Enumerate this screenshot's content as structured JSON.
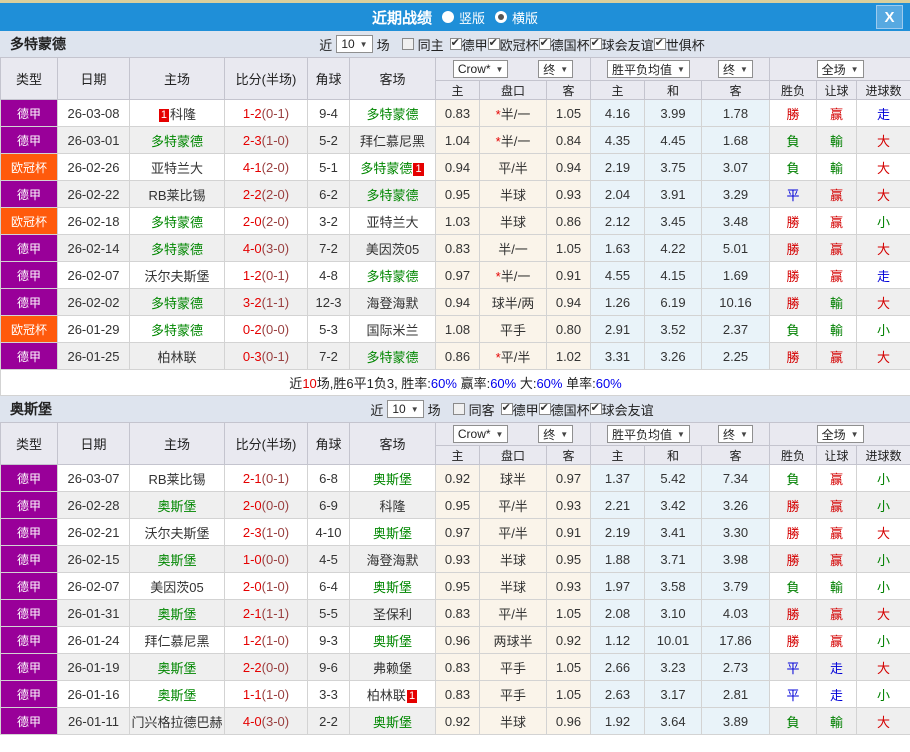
{
  "titlebar": {
    "title": "近期战绩",
    "radios": [
      {
        "label": "竖版",
        "selected": false
      },
      {
        "label": "横版",
        "selected": true
      }
    ],
    "close_label": "X"
  },
  "filter": {
    "near_label": "近",
    "near_value": "10",
    "games_label": "场"
  },
  "table_header": {
    "main_cols": [
      "类型",
      "日期",
      "主场",
      "比分(半场)",
      "角球",
      "客场"
    ],
    "sub_cols": [
      "主",
      "盘口",
      "客",
      "主",
      "和",
      "客",
      "胜负",
      "让球",
      "进球数"
    ],
    "odds_select": "Crow*",
    "odds_final_select": "终",
    "avg_select": "胜平负均值",
    "avg_final_select": "终",
    "scope_select": "全场"
  },
  "colors": {
    "titlebar_blue": "#1f8fd8",
    "top_strip": "#d9cf9d",
    "league_purple": "#990099",
    "league_orange": "#ff5a0c",
    "team_green": "#008700",
    "score_red": "#e50000",
    "win_red": "#d40000",
    "lose_green": "#008000",
    "neutral_blue": "#0000d8",
    "rate_blue": "#0000ee",
    "text_dark": "#222222"
  },
  "teams": [
    {
      "name": "多特蒙德",
      "same_label": "同主",
      "same_checked": false,
      "leagues": [
        "德甲",
        "欧冠杯",
        "德国杯",
        "球会友谊",
        "世俱杯"
      ],
      "rows": [
        {
          "league": "德甲",
          "league_color": "league_purple",
          "date": "26-03-08",
          "home": {
            "name": "科隆",
            "green": false,
            "card_pre": "1"
          },
          "score": "1-2",
          "half": "(0-1)",
          "corner": "9-4",
          "away": {
            "name": "多特蒙德",
            "green": true
          },
          "crow": [
            "0.83",
            "*半/一",
            "1.05"
          ],
          "avg": [
            "4.16",
            "3.99",
            "1.78"
          ],
          "outcome": [
            {
              "t": "勝",
              "c": "r"
            },
            {
              "t": "赢",
              "c": "r"
            },
            {
              "t": "走",
              "c": "b"
            }
          ]
        },
        {
          "league": "德甲",
          "league_color": "league_purple",
          "date": "26-03-01",
          "home": {
            "name": "多特蒙德",
            "green": true
          },
          "score": "2-3",
          "half": "(1-0)",
          "corner": "5-2",
          "away": {
            "name": "拜仁慕尼黑",
            "green": false
          },
          "crow": [
            "1.04",
            "*半/一",
            "0.84"
          ],
          "avg": [
            "4.35",
            "4.45",
            "1.68"
          ],
          "outcome": [
            {
              "t": "負",
              "c": "g"
            },
            {
              "t": "輸",
              "c": "g"
            },
            {
              "t": "大",
              "c": "r"
            }
          ]
        },
        {
          "league": "欧冠杯",
          "league_color": "league_orange",
          "date": "26-02-26",
          "home": {
            "name": "亚特兰大",
            "green": false
          },
          "score": "4-1",
          "half": "(2-0)",
          "corner": "5-1",
          "away": {
            "name": "多特蒙德",
            "green": true,
            "card_post": "1"
          },
          "crow": [
            "0.94",
            "平/半",
            "0.94"
          ],
          "avg": [
            "2.19",
            "3.75",
            "3.07"
          ],
          "outcome": [
            {
              "t": "負",
              "c": "g"
            },
            {
              "t": "輸",
              "c": "g"
            },
            {
              "t": "大",
              "c": "r"
            }
          ]
        },
        {
          "league": "德甲",
          "league_color": "league_purple",
          "date": "26-02-22",
          "home": {
            "name": "RB莱比锡",
            "green": false
          },
          "score": "2-2",
          "half": "(2-0)",
          "corner": "6-2",
          "away": {
            "name": "多特蒙德",
            "green": true
          },
          "crow": [
            "0.95",
            "半球",
            "0.93"
          ],
          "avg": [
            "2.04",
            "3.91",
            "3.29"
          ],
          "outcome": [
            {
              "t": "平",
              "c": "b"
            },
            {
              "t": "赢",
              "c": "r"
            },
            {
              "t": "大",
              "c": "r"
            }
          ]
        },
        {
          "league": "欧冠杯",
          "league_color": "league_orange",
          "date": "26-02-18",
          "home": {
            "name": "多特蒙德",
            "green": true
          },
          "score": "2-0",
          "half": "(2-0)",
          "corner": "3-2",
          "away": {
            "name": "亚特兰大",
            "green": false
          },
          "crow": [
            "1.03",
            "半球",
            "0.86"
          ],
          "avg": [
            "2.12",
            "3.45",
            "3.48"
          ],
          "outcome": [
            {
              "t": "勝",
              "c": "r"
            },
            {
              "t": "赢",
              "c": "r"
            },
            {
              "t": "小",
              "c": "g"
            }
          ]
        },
        {
          "league": "德甲",
          "league_color": "league_purple",
          "date": "26-02-14",
          "home": {
            "name": "多特蒙德",
            "green": true
          },
          "score": "4-0",
          "half": "(3-0)",
          "corner": "7-2",
          "away": {
            "name": "美因茨05",
            "green": false
          },
          "crow": [
            "0.83",
            "半/一",
            "1.05"
          ],
          "avg": [
            "1.63",
            "4.22",
            "5.01"
          ],
          "outcome": [
            {
              "t": "勝",
              "c": "r"
            },
            {
              "t": "赢",
              "c": "r"
            },
            {
              "t": "大",
              "c": "r"
            }
          ]
        },
        {
          "league": "德甲",
          "league_color": "league_purple",
          "date": "26-02-07",
          "home": {
            "name": "沃尔夫斯堡",
            "green": false
          },
          "score": "1-2",
          "half": "(0-1)",
          "corner": "4-8",
          "away": {
            "name": "多特蒙德",
            "green": true
          },
          "crow": [
            "0.97",
            "*半/一",
            "0.91"
          ],
          "avg": [
            "4.55",
            "4.15",
            "1.69"
          ],
          "outcome": [
            {
              "t": "勝",
              "c": "r"
            },
            {
              "t": "赢",
              "c": "r"
            },
            {
              "t": "走",
              "c": "b"
            }
          ]
        },
        {
          "league": "德甲",
          "league_color": "league_purple",
          "date": "26-02-02",
          "home": {
            "name": "多特蒙德",
            "green": true
          },
          "score": "3-2",
          "half": "(1-1)",
          "corner": "12-3",
          "away": {
            "name": "海登海默",
            "green": false
          },
          "crow": [
            "0.94",
            "球半/两",
            "0.94"
          ],
          "avg": [
            "1.26",
            "6.19",
            "10.16"
          ],
          "outcome": [
            {
              "t": "勝",
              "c": "r"
            },
            {
              "t": "輸",
              "c": "g"
            },
            {
              "t": "大",
              "c": "r"
            }
          ]
        },
        {
          "league": "欧冠杯",
          "league_color": "league_orange",
          "date": "26-01-29",
          "home": {
            "name": "多特蒙德",
            "green": true
          },
          "score": "0-2",
          "half": "(0-0)",
          "corner": "5-3",
          "away": {
            "name": "国际米兰",
            "green": false
          },
          "crow": [
            "1.08",
            "平手",
            "0.80"
          ],
          "avg": [
            "2.91",
            "3.52",
            "2.37"
          ],
          "outcome": [
            {
              "t": "負",
              "c": "g"
            },
            {
              "t": "輸",
              "c": "g"
            },
            {
              "t": "小",
              "c": "g"
            }
          ]
        },
        {
          "league": "德甲",
          "league_color": "league_purple",
          "date": "26-01-25",
          "home": {
            "name": "柏林联",
            "green": false
          },
          "score": "0-3",
          "half": "(0-1)",
          "corner": "7-2",
          "away": {
            "name": "多特蒙德",
            "green": true
          },
          "crow": [
            "0.86",
            "*平/半",
            "1.02"
          ],
          "avg": [
            "3.31",
            "3.26",
            "2.25"
          ],
          "outcome": [
            {
              "t": "勝",
              "c": "r"
            },
            {
              "t": "赢",
              "c": "r"
            },
            {
              "t": "大",
              "c": "r"
            }
          ]
        }
      ],
      "summary": [
        {
          "t": "近",
          "c": "k"
        },
        {
          "t": "10",
          "c": "r"
        },
        {
          "t": "场,胜6平1负3, 胜率:",
          "c": "k"
        },
        {
          "t": "60%",
          "c": "b"
        },
        {
          "t": " 赢率:",
          "c": "k"
        },
        {
          "t": "60%",
          "c": "b"
        },
        {
          "t": " 大:",
          "c": "k"
        },
        {
          "t": "60%",
          "c": "b"
        },
        {
          "t": " 单率:",
          "c": "k"
        },
        {
          "t": "60%",
          "c": "b"
        }
      ]
    },
    {
      "name": "奥斯堡",
      "same_label": "同客",
      "same_checked": false,
      "leagues": [
        "德甲",
        "德国杯",
        "球会友谊"
      ],
      "rows": [
        {
          "league": "德甲",
          "league_color": "league_purple",
          "date": "26-03-07",
          "home": {
            "name": "RB莱比锡",
            "green": false
          },
          "score": "2-1",
          "half": "(0-1)",
          "corner": "6-8",
          "away": {
            "name": "奥斯堡",
            "green": true
          },
          "crow": [
            "0.92",
            "球半",
            "0.97"
          ],
          "avg": [
            "1.37",
            "5.42",
            "7.34"
          ],
          "outcome": [
            {
              "t": "負",
              "c": "g"
            },
            {
              "t": "赢",
              "c": "r"
            },
            {
              "t": "小",
              "c": "g"
            }
          ]
        },
        {
          "league": "德甲",
          "league_color": "league_purple",
          "date": "26-02-28",
          "home": {
            "name": "奥斯堡",
            "green": true
          },
          "score": "2-0",
          "half": "(0-0)",
          "corner": "6-9",
          "away": {
            "name": "科隆",
            "green": false
          },
          "crow": [
            "0.95",
            "平/半",
            "0.93"
          ],
          "avg": [
            "2.21",
            "3.42",
            "3.26"
          ],
          "outcome": [
            {
              "t": "勝",
              "c": "r"
            },
            {
              "t": "赢",
              "c": "r"
            },
            {
              "t": "小",
              "c": "g"
            }
          ]
        },
        {
          "league": "德甲",
          "league_color": "league_purple",
          "date": "26-02-21",
          "home": {
            "name": "沃尔夫斯堡",
            "green": false
          },
          "score": "2-3",
          "half": "(1-0)",
          "corner": "4-10",
          "away": {
            "name": "奥斯堡",
            "green": true
          },
          "crow": [
            "0.97",
            "平/半",
            "0.91"
          ],
          "avg": [
            "2.19",
            "3.41",
            "3.30"
          ],
          "outcome": [
            {
              "t": "勝",
              "c": "r"
            },
            {
              "t": "赢",
              "c": "r"
            },
            {
              "t": "大",
              "c": "r"
            }
          ]
        },
        {
          "league": "德甲",
          "league_color": "league_purple",
          "date": "26-02-15",
          "home": {
            "name": "奥斯堡",
            "green": true
          },
          "score": "1-0",
          "half": "(0-0)",
          "corner": "4-5",
          "away": {
            "name": "海登海默",
            "green": false
          },
          "crow": [
            "0.93",
            "半球",
            "0.95"
          ],
          "avg": [
            "1.88",
            "3.71",
            "3.98"
          ],
          "outcome": [
            {
              "t": "勝",
              "c": "r"
            },
            {
              "t": "赢",
              "c": "r"
            },
            {
              "t": "小",
              "c": "g"
            }
          ]
        },
        {
          "league": "德甲",
          "league_color": "league_purple",
          "date": "26-02-07",
          "home": {
            "name": "美因茨05",
            "green": false
          },
          "score": "2-0",
          "half": "(1-0)",
          "corner": "6-4",
          "away": {
            "name": "奥斯堡",
            "green": true
          },
          "crow": [
            "0.95",
            "半球",
            "0.93"
          ],
          "avg": [
            "1.97",
            "3.58",
            "3.79"
          ],
          "outcome": [
            {
              "t": "負",
              "c": "g"
            },
            {
              "t": "輸",
              "c": "g"
            },
            {
              "t": "小",
              "c": "g"
            }
          ]
        },
        {
          "league": "德甲",
          "league_color": "league_purple",
          "date": "26-01-31",
          "home": {
            "name": "奥斯堡",
            "green": true
          },
          "score": "2-1",
          "half": "(1-1)",
          "corner": "5-5",
          "away": {
            "name": "圣保利",
            "green": false
          },
          "crow": [
            "0.83",
            "平/半",
            "1.05"
          ],
          "avg": [
            "2.08",
            "3.10",
            "4.03"
          ],
          "outcome": [
            {
              "t": "勝",
              "c": "r"
            },
            {
              "t": "赢",
              "c": "r"
            },
            {
              "t": "大",
              "c": "r"
            }
          ]
        },
        {
          "league": "德甲",
          "league_color": "league_purple",
          "date": "26-01-24",
          "home": {
            "name": "拜仁慕尼黑",
            "green": false
          },
          "score": "1-2",
          "half": "(1-0)",
          "corner": "9-3",
          "away": {
            "name": "奥斯堡",
            "green": true
          },
          "crow": [
            "0.96",
            "两球半",
            "0.92"
          ],
          "avg": [
            "1.12",
            "10.01",
            "17.86"
          ],
          "outcome": [
            {
              "t": "勝",
              "c": "r"
            },
            {
              "t": "赢",
              "c": "r"
            },
            {
              "t": "小",
              "c": "g"
            }
          ]
        },
        {
          "league": "德甲",
          "league_color": "league_purple",
          "date": "26-01-19",
          "home": {
            "name": "奥斯堡",
            "green": true
          },
          "score": "2-2",
          "half": "(0-0)",
          "corner": "9-6",
          "away": {
            "name": "弗赖堡",
            "green": false
          },
          "crow": [
            "0.83",
            "平手",
            "1.05"
          ],
          "avg": [
            "2.66",
            "3.23",
            "2.73"
          ],
          "outcome": [
            {
              "t": "平",
              "c": "b"
            },
            {
              "t": "走",
              "c": "b"
            },
            {
              "t": "大",
              "c": "r"
            }
          ]
        },
        {
          "league": "德甲",
          "league_color": "league_purple",
          "date": "26-01-16",
          "home": {
            "name": "奥斯堡",
            "green": true
          },
          "score": "1-1",
          "half": "(1-0)",
          "corner": "3-3",
          "away": {
            "name": "柏林联",
            "green": false,
            "card_post": "1"
          },
          "crow": [
            "0.83",
            "平手",
            "1.05"
          ],
          "avg": [
            "2.63",
            "3.17",
            "2.81"
          ],
          "outcome": [
            {
              "t": "平",
              "c": "b"
            },
            {
              "t": "走",
              "c": "b"
            },
            {
              "t": "小",
              "c": "g"
            }
          ]
        },
        {
          "league": "德甲",
          "league_color": "league_purple",
          "date": "26-01-11",
          "home": {
            "name": "门兴格拉德巴赫",
            "green": false
          },
          "score": "4-0",
          "half": "(3-0)",
          "corner": "2-2",
          "away": {
            "name": "奥斯堡",
            "green": true
          },
          "crow": [
            "0.92",
            "半球",
            "0.96"
          ],
          "avg": [
            "1.92",
            "3.64",
            "3.89"
          ],
          "outcome": [
            {
              "t": "負",
              "c": "g"
            },
            {
              "t": "輸",
              "c": "g"
            },
            {
              "t": "大",
              "c": "r"
            }
          ]
        }
      ],
      "summary": null
    }
  ]
}
